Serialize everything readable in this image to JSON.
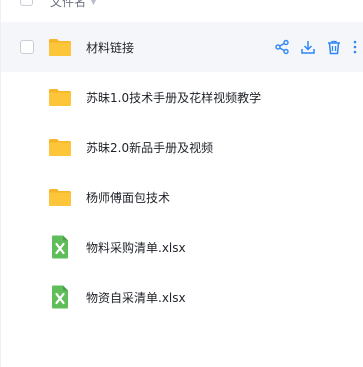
{
  "header": {
    "name_label": "文件名"
  },
  "rows": [
    {
      "name": "材料链接",
      "icon": "folder-icon",
      "hover": true
    },
    {
      "name": "苏昧1.0技术手册及花样视频教学",
      "icon": "folder-icon"
    },
    {
      "name": "苏昧2.0新品手册及视频",
      "icon": "folder-icon"
    },
    {
      "name": "杨师傅面包技术",
      "icon": "folder-icon"
    },
    {
      "name": "物料采购清单.xlsx",
      "icon": "excel-icon"
    },
    {
      "name": "物资自采清单.xlsx",
      "icon": "excel-icon"
    }
  ],
  "colors": {
    "folder": "#fcc53a",
    "excel": "#5fbe5a",
    "action": "#2f86f6"
  }
}
